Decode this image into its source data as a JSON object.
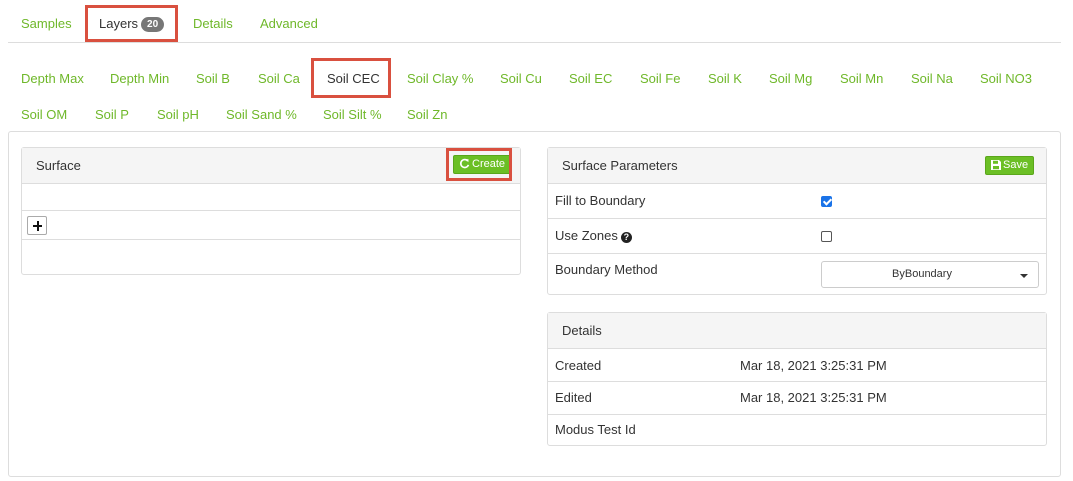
{
  "top_tabs": [
    {
      "label": "Samples"
    },
    {
      "label": "Layers",
      "badge": "20"
    },
    {
      "label": "Details"
    },
    {
      "label": "Advanced"
    }
  ],
  "layer_tabs_row1": [
    "Depth Max",
    "Depth Min",
    "Soil B",
    "Soil Ca",
    "Soil CEC",
    "Soil Clay %",
    "Soil Cu",
    "Soil EC",
    "Soil Fe",
    "Soil K",
    "Soil Mg",
    "Soil Mn",
    "Soil Na",
    "Soil NO3"
  ],
  "layer_tabs_row2": [
    "Soil OM",
    "Soil P",
    "Soil pH",
    "Soil Sand %",
    "Soil Silt %",
    "Soil Zn"
  ],
  "active_layer": "Soil CEC",
  "surface_panel": {
    "title": "Surface",
    "create_label": "Create"
  },
  "params_panel": {
    "title": "Surface Parameters",
    "save_label": "Save",
    "fill_to_boundary": {
      "label": "Fill to Boundary",
      "checked": true
    },
    "use_zones": {
      "label": "Use Zones",
      "checked": false
    },
    "boundary_method": {
      "label": "Boundary Method",
      "value": "ByBoundary"
    }
  },
  "details_panel": {
    "title": "Details",
    "rows": [
      {
        "label": "Created",
        "value": "Mar 18, 2021 3:25:31 PM"
      },
      {
        "label": "Edited",
        "value": "Mar 18, 2021 3:25:31 PM"
      },
      {
        "label": "Modus Test Id",
        "value": ""
      }
    ]
  },
  "colors": {
    "accent_green": "#6fb82a",
    "button_green": "#6bbf25",
    "highlight_red": "#d9503f"
  }
}
